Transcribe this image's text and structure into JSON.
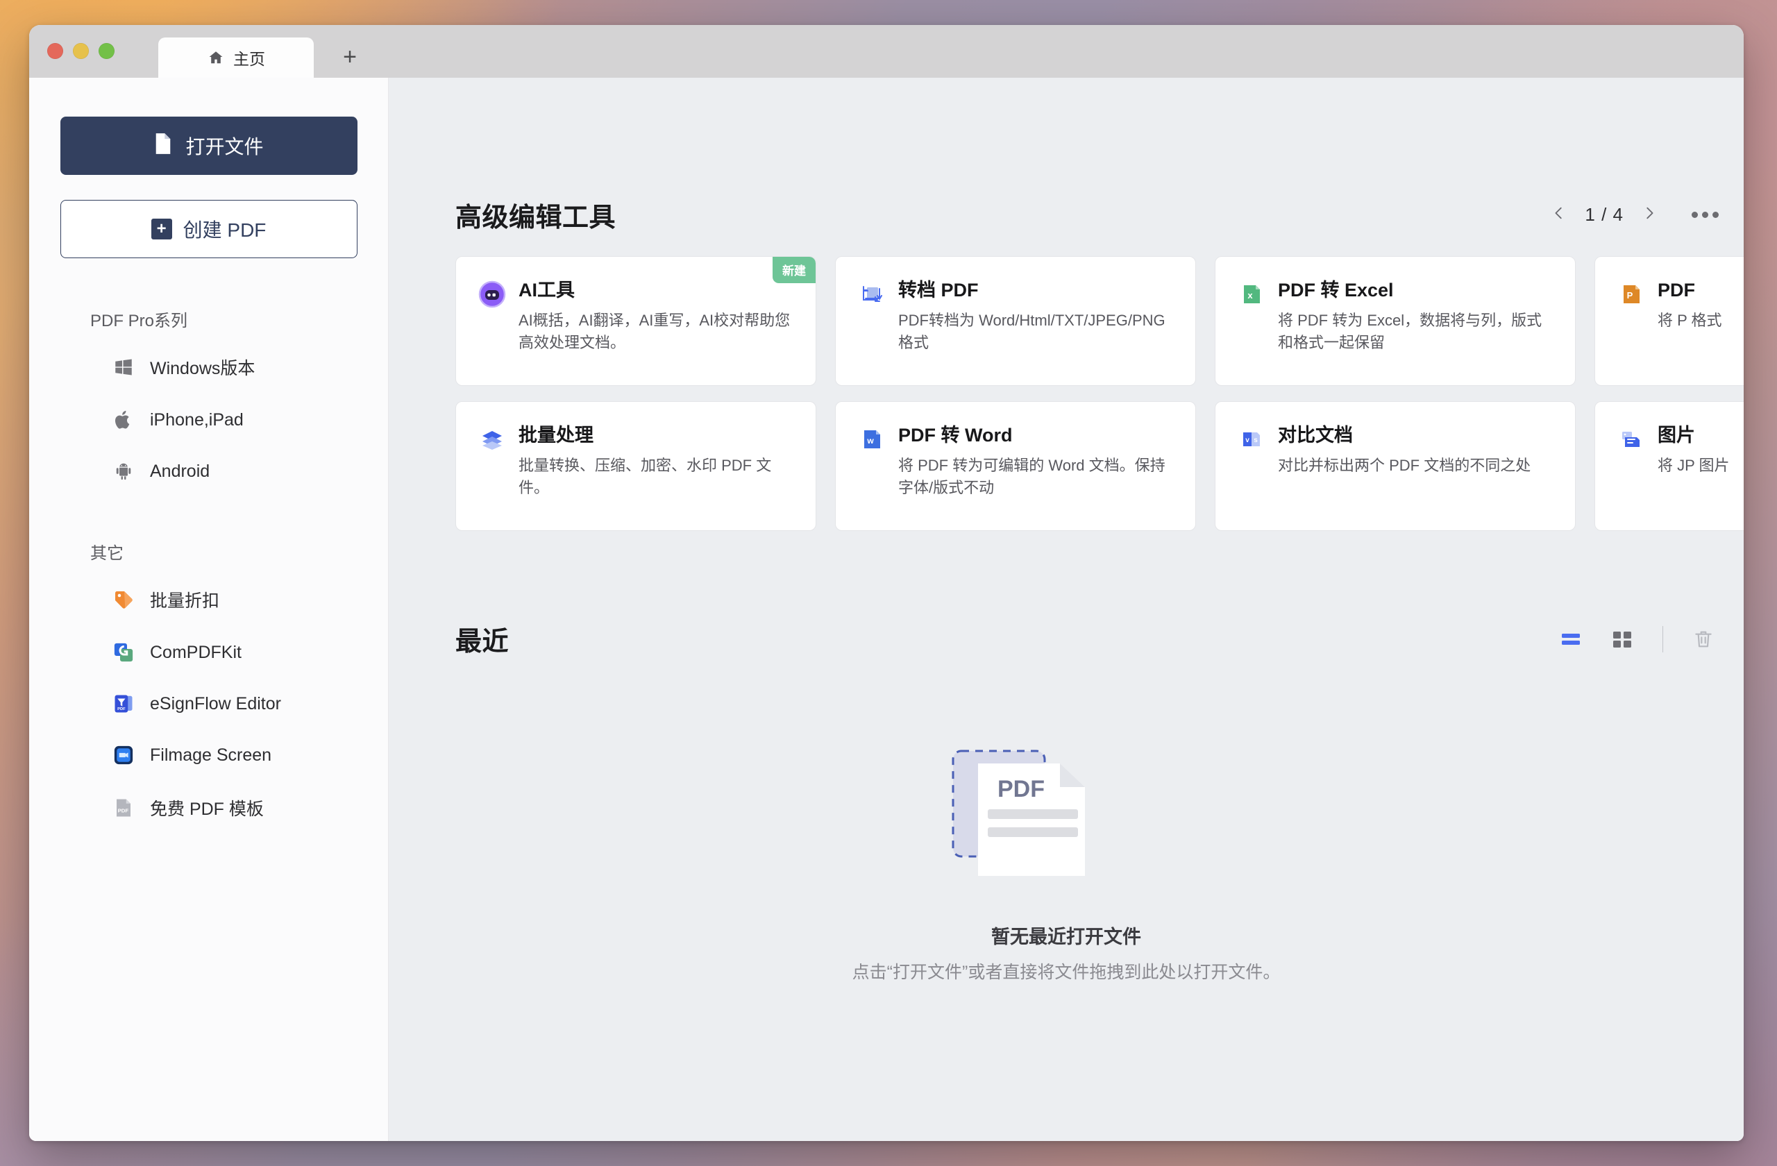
{
  "window": {
    "traffic_lights": [
      "close",
      "minimize",
      "zoom"
    ],
    "tab_label": "主页",
    "new_tab_label": "+"
  },
  "sidebar": {
    "open_file_button": "打开文件",
    "create_pdf_button": "创建 PDF",
    "groups": [
      {
        "title": "PDF Pro系列",
        "items": [
          {
            "label": "Windows版本",
            "icon": "windows-icon"
          },
          {
            "label": "iPhone,iPad",
            "icon": "apple-icon"
          },
          {
            "label": "Android",
            "icon": "android-icon"
          }
        ]
      },
      {
        "title": "其它",
        "items": [
          {
            "label": "批量折扣",
            "icon": "tag-icon"
          },
          {
            "label": "ComPDFKit",
            "icon": "compdfkit-icon"
          },
          {
            "label": "eSignFlow Editor",
            "icon": "esignflow-icon"
          },
          {
            "label": "Filmage Screen",
            "icon": "filmage-icon"
          },
          {
            "label": "免费 PDF 模板",
            "icon": "pdf-template-icon"
          }
        ]
      }
    ]
  },
  "tools_section": {
    "title": "高级编辑工具",
    "pager": {
      "prev": "‹",
      "page_text": "1 / 4",
      "next": "›",
      "more": "•••"
    },
    "cards": [
      {
        "title": "AI工具",
        "desc": "AI概括，AI翻译，AI重写，AI校对帮助您高效处理文档。",
        "icon": "ai-robot-icon",
        "badge": "新建"
      },
      {
        "title": "转档 PDF",
        "desc": "PDF转档为 Word/Html/TXT/JPEG/PNG 格式",
        "icon": "convert-pdf-icon",
        "badge": ""
      },
      {
        "title": "PDF 转 Excel",
        "desc": "将 PDF 转为 Excel，数据将与列，版式和格式一起保留",
        "icon": "excel-icon",
        "badge": ""
      },
      {
        "title": "PDF",
        "desc": "将 P\n格式",
        "icon": "powerpoint-icon",
        "badge": ""
      },
      {
        "title": "批量处理",
        "desc": "批量转换、压缩、加密、水印 PDF 文件。",
        "icon": "layers-icon",
        "badge": ""
      },
      {
        "title": "PDF 转 Word",
        "desc": "将 PDF 转为可编辑的 Word 文档。保持字体/版式不动",
        "icon": "word-icon",
        "badge": ""
      },
      {
        "title": "对比文档",
        "desc": "对比并标出两个 PDF 文档的不同之处",
        "icon": "compare-vs-icon",
        "badge": ""
      },
      {
        "title": "图片",
        "desc": "将 JP\n图片",
        "icon": "image-to-pdf-icon",
        "badge": ""
      }
    ]
  },
  "recent_section": {
    "title": "最近",
    "view_list_label": "list-view",
    "view_grid_label": "grid-view",
    "delete_label": "clear-recent",
    "empty_title": "暂无最近打开文件",
    "empty_sub": "点击“打开文件”或者直接将文件拖拽到此处以打开文件。",
    "empty_art_label": "PDF"
  },
  "colors": {
    "accent": "#33405f",
    "badge_green": "#6ec597",
    "active_blue": "#4a6cf0",
    "main_bg": "#eceef1"
  }
}
